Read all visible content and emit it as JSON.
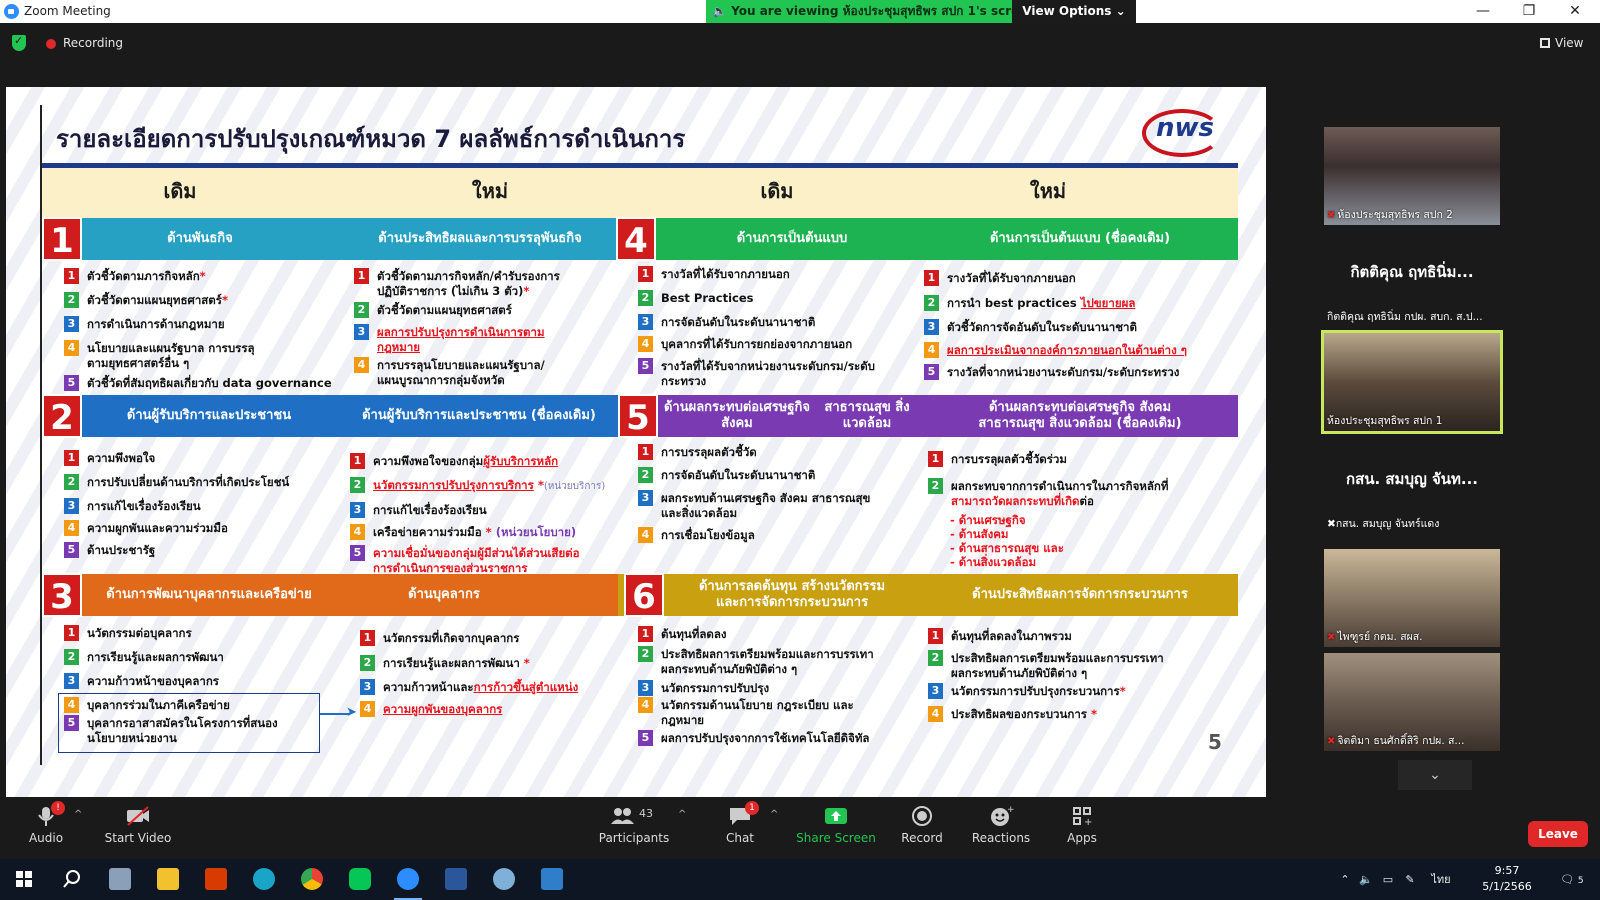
{
  "window": {
    "title": "Zoom Meeting",
    "share_banner": "You are viewing ห้องประชุมสุทธิพร สปก 1's screen",
    "view_options": "View Options",
    "min": "—",
    "max": "❐",
    "close": "✕"
  },
  "meeting_bar": {
    "recording": "Recording",
    "view": "View"
  },
  "slide": {
    "title": "รายละเอียดการปรับปรุงเกณฑ์หมวด 7 ผลลัพธ์การดำเนินการ",
    "logo": "nws",
    "col_old_1": "เดิม",
    "col_new_1": "ใหม่",
    "col_old_2": "เดิม",
    "col_new_2": "ใหม่",
    "page_number": "5",
    "sections": {
      "s1": {
        "num": "1",
        "old_head": "ด้านพันธกิจ",
        "new_head": "ด้านประสิทธิผลและการบรรลุพันธกิจ",
        "old_items": [
          "ตัวชี้วัดตามภารกิจหลัก",
          "ตัวชี้วัดตามแผนยุทธศาสตร์",
          "การดำเนินการด้านกฎหมาย",
          "นโยบายและแผนรัฐบาล การบรรลุ",
          "ตามยุทธศาสตร์อื่น ๆ",
          "ตัวชี้วัดที่สัมฤทธิผลเกี่ยวกับ data governance"
        ],
        "new_items": [
          "ตัวชี้วัดตามภารกิจหลัก/คำรับรองการ",
          "ปฏิบัติราชการ (ไม่เกิน 3 ตัว)",
          "ตัวชี้วัดตามแผนยุทธศาสตร์",
          "ผลการปรับปรุงการดำเนินการตาม",
          "กฎหมาย",
          "การบรรลุนโยบายและแผนรัฐบาล/",
          "แผนบูรณาการกลุ่มจังหวัด"
        ]
      },
      "s2": {
        "num": "2",
        "old_head": "ด้านผู้รับบริการและประชาชน",
        "new_head": "ด้านผู้รับบริการและประชาชน (ชื่อคงเดิม)",
        "old_items": [
          "ความพึงพอใจ",
          "การปรับเปลี่ยนด้านบริการที่เกิดประโยชน์",
          "การแก้ไขเรื่องร้องเรียน",
          "ความผูกพันและความร่วมมือ",
          "ด้านประชารัฐ"
        ],
        "new_items": [
          "ความพึงพอใจของกลุ่ม",
          "ผู้รับบริการหลัก",
          "นวัตกรรมการปรับปรุงการบริการ",
          "(หน่วยบริการ)",
          "การแก้ไขเรื่องร้องเรียน",
          "เครือข่ายความร่วมมือ",
          "(หน่วยนโยบาย)",
          "ความเชื่อมั่นของกลุ่มผู้มีส่วนได้ส่วนเสียต่อ",
          "การดำเนินการของส่วนราชการ"
        ]
      },
      "s3": {
        "num": "3",
        "old_head": "ด้านการพัฒนาบุคลากรและเครือข่าย",
        "new_head": "ด้านบุคลากร",
        "old_items": [
          "นวัตกรรมต่อบุคลากร",
          "การเรียนรู้และผลการพัฒนา",
          "ความก้าวหน้าของบุคลากร",
          "บุคลากรร่วมในภาคีเครือข่าย",
          "บุคลากรอาสาสมัครในโครงการที่สนอง",
          "นโยบายหน่วยงาน"
        ],
        "new_items": [
          "นวัตกรรมที่เกิดจากบุคลากร",
          "การเรียนรู้และผลการพัฒนา",
          "ความก้าวหน้าและ",
          "การก้าวขึ้นสู่ตำแหน่ง",
          "ความผูกพันของบุคลากร"
        ]
      },
      "s4": {
        "num": "4",
        "old_head": "ด้านการเป็นต้นแบบ",
        "new_head": "ด้านการเป็นต้นแบบ (ชื่อคงเดิม)",
        "old_items": [
          "รางวัลที่ได้รับจากภายนอก",
          "Best Practices",
          "การจัดอันดับในระดับนานาชาติ",
          "บุคลากรที่ได้รับการยกย่องจากภายนอก",
          "รางวัลที่ได้รับจากหน่วยงานระดับกรม/ระดับ",
          "กระทรวง"
        ],
        "new_items": [
          "รางวัลที่ได้รับจากภายนอก",
          "การนำ best practices",
          "ไปขยายผล",
          "ตัวชี้วัดการจัดอันดับในระดับนานาชาติ",
          "ผลการประเมินจากองค์การภายนอกในด้านต่าง ๆ",
          "รางวัลที่จากหน่วยงานระดับกรม/ระดับกระทรวง"
        ]
      },
      "s5": {
        "num": "5",
        "old_head_1": "ด้านผลกระทบต่อเศรษฐกิจ สังคม",
        "old_head_2": "สาธารณสุข สิ่งแวดล้อม",
        "new_head_1": "ด้านผลกระทบต่อเศรษฐกิจ สังคม",
        "new_head_2": "สาธารณสุข สิ่งแวดล้อม (ชื่อคงเดิม)",
        "old_items": [
          "การบรรลุผลตัวชี้วัด",
          "การจัดอันดับในระดับนานาชาติ",
          "ผลกระทบด้านเศรษฐกิจ สังคม สาธารณสุข",
          "และสิ่งแวดล้อม",
          "การเชื่อมโยงข้อมูล"
        ],
        "new_items": [
          "การบรรลุผลตัวชี้วัดร่วม",
          "ผลกระทบจากการดำเนินการในภารกิจหลักที่",
          "สามารถวัดผลกระทบที่เกิด",
          "ต่อ",
          "ด้านเศรษฐกิจ",
          "ด้านสังคม",
          "ด้านสาธารณสุข และ",
          "ด้านสิ่งแวดล้อม"
        ]
      },
      "s6": {
        "num": "6",
        "old_head_1": "ด้านการลดต้นทุน สร้างนวัตกรรม",
        "old_head_2": "และการจัดการกระบวนการ",
        "new_head": "ด้านประสิทธิผลการจัดการกระบวนการ",
        "old_items": [
          "ต้นทุนที่ลดลง",
          "ประสิทธิผลการเตรียมพร้อมและการบรรเทา",
          "ผลกระทบด้านภัยพิบัติต่าง ๆ",
          "นวัตกรรมการปรับปรุง",
          "นวัตกรรมด้านนโยบาย กฎระเบียบ และ",
          "กฎหมาย",
          "ผลการปรับปรุงจากการใช้เทคโนโลยีดิจิทัล"
        ],
        "new_items": [
          "ต้นทุนที่ลดลงในภาพรวม",
          "ประสิทธิผลการเตรียมพร้อมและการบรรเทา",
          "ผลกระทบด้านภัยพิบัติต่าง ๆ",
          "นวัตกรรมการปรับปรุงกระบวนการ",
          "ประสิทธิผลของกระบวนการ"
        ]
      }
    }
  },
  "participants_panel": {
    "tiles": [
      {
        "caption": "ห้องประชุมสุทธิพร สปก 2"
      },
      {
        "big_name": "กิตติคุณ ฤทธินิ่ม...",
        "caption": "กิตติคุณ ฤทธินิ่ม กปผ. สบก. ส.ป..."
      },
      {
        "caption": "ห้องประชุมสุทธิพร สปก 1"
      },
      {
        "big_name": "กสน. สมบุญ จันท...",
        "caption": "กสน. สมบุญ จันทร์แดง"
      },
      {
        "caption": "ไพฑูรย์ กตม. สผส."
      },
      {
        "caption": "จิตติมา ธนศักดิ์สิริ กปผ. ส..."
      }
    ],
    "scroll_down": "⌄"
  },
  "toolbar": {
    "audio": "Audio",
    "audio_badge": "!",
    "start_video": "Start Video",
    "participants": "Participants",
    "participants_count": "43",
    "chat": "Chat",
    "chat_badge": "1",
    "share_screen": "Share Screen",
    "record": "Record",
    "reactions": "Reactions",
    "apps": "Apps",
    "leave": "Leave"
  },
  "taskbar": {
    "time": "9:57",
    "date": "5/1/2566",
    "lang": "ไทย",
    "notif": "5"
  }
}
